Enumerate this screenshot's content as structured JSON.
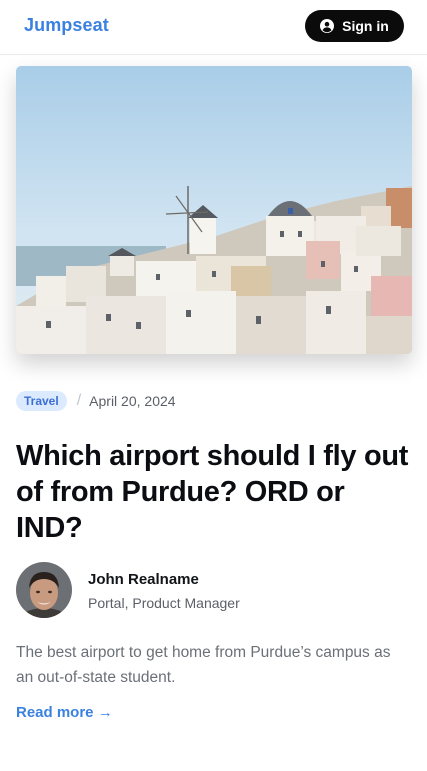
{
  "header": {
    "logo": "Jumpseat",
    "signin_label": "Sign in",
    "signin_icon": "user-circle-icon",
    "accent": "#3b82e0"
  },
  "post": {
    "hero_alt": "White-washed buildings and windmill overlooking the sea",
    "category": "Travel",
    "date": "April 20, 2024",
    "title": "Which airport should I fly out of from Purdue? ORD or IND?",
    "author": {
      "name": "John Realname",
      "role": "Portal, Product Manager"
    },
    "excerpt": "The best airport to get home from Purdue’s campus as an out-of-state student.",
    "read_more": "Read more →"
  }
}
